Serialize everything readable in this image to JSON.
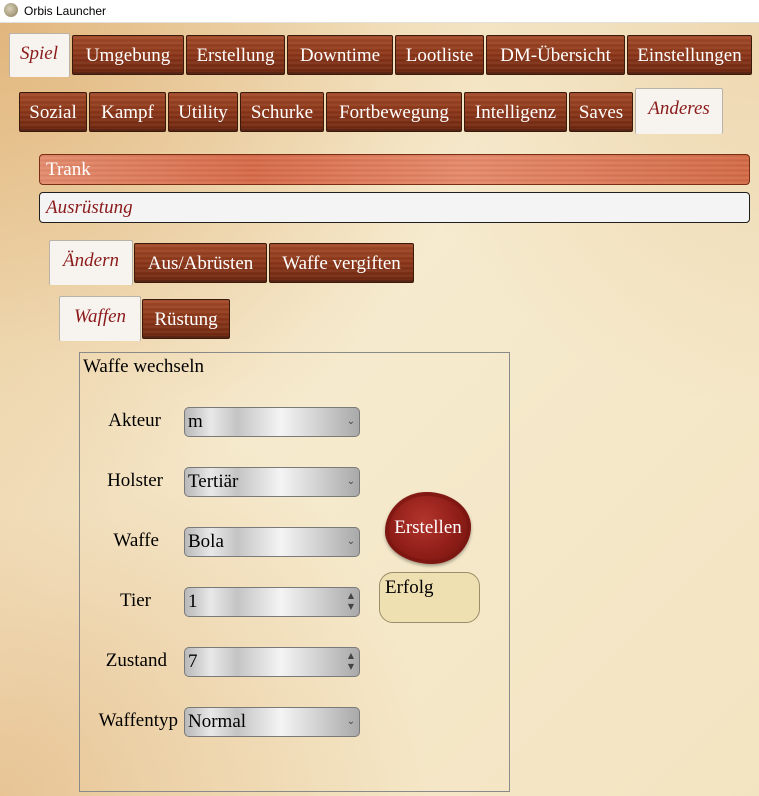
{
  "window": {
    "title": "Orbis Launcher"
  },
  "main_tabs": [
    "Spiel",
    "Umgebung",
    "Erstellung",
    "Downtime",
    "Lootliste",
    "DM-Übersicht",
    "Einstellungen"
  ],
  "sub_tabs": [
    "Sozial",
    "Kampf",
    "Utility",
    "Schurke",
    "Fortbewegung",
    "Intelligenz",
    "Saves",
    "Anderes"
  ],
  "sections": {
    "trank": "Trank",
    "ausruestung": "Ausrüstung"
  },
  "action_tabs": [
    "Ändern",
    "Aus/Abrüsten",
    "Waffe vergiften"
  ],
  "item_tabs": [
    "Waffen",
    "Rüstung"
  ],
  "form": {
    "title": "Waffe wechseln",
    "fields": [
      {
        "label": "Akteur",
        "value": "m"
      },
      {
        "label": "Holster",
        "value": "Tertiär"
      },
      {
        "label": "Waffe",
        "value": "Bola"
      },
      {
        "label": "Tier",
        "value": "1"
      },
      {
        "label": "Zustand",
        "value": "7"
      },
      {
        "label": "Waffentyp",
        "value": "Normal"
      }
    ],
    "create_label": "Erstellen",
    "status": "Erfolg"
  },
  "colors": {
    "wood": "#8a3518",
    "accent_text": "#8b1a1a",
    "seal": "#8e1d17",
    "status_bg": "#efe0b2"
  }
}
